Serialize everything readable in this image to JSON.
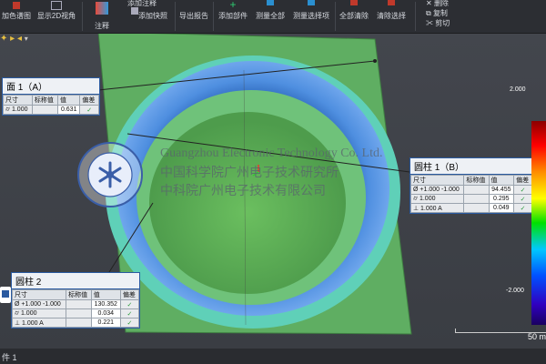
{
  "toolbar": {
    "items": [
      {
        "label": "加色谱图"
      },
      {
        "label": "显示2D视角"
      },
      {
        "label": "注释"
      },
      {
        "label": "添加快照"
      },
      {
        "label": "导出报告"
      },
      {
        "label": "添加部件"
      },
      {
        "label": "测量全部"
      },
      {
        "label": "测量选择项"
      },
      {
        "label": "全部清除"
      },
      {
        "label": "清除选择"
      }
    ],
    "small": {
      "top": "添加注释",
      "delete": "删除",
      "copy": "复制",
      "cut": "剪切"
    }
  },
  "panels": {
    "face1": {
      "title": "面 1（A）",
      "headers": [
        "尺寸",
        "标称值",
        "值",
        "偏差"
      ],
      "rows": [
        {
          "sym": "⌭ 1.000",
          "nominal": "",
          "value": "0.631",
          "mark": "✓"
        }
      ]
    },
    "cyl1": {
      "title": "圆柱 1（B）",
      "headers": [
        "尺寸",
        "标称值",
        "值",
        "偏差"
      ],
      "rows": [
        {
          "sym": "Ø +1.000 -1.000",
          "nominal": "",
          "value": "94.455",
          "mark": "✓"
        },
        {
          "sym": "⌭ 1.000",
          "nominal": "",
          "value": "0.295",
          "mark": "✓"
        },
        {
          "sym": "⊥ 1.000 A",
          "nominal": "",
          "value": "0.049",
          "mark": "✓"
        }
      ]
    },
    "cyl2": {
      "title": "圆柱 2",
      "headers": [
        "尺寸",
        "标称值",
        "值",
        "偏差"
      ],
      "rows": [
        {
          "sym": "Ø +1.000 -1.000",
          "nominal": "",
          "value": "130.352",
          "mark": "✓"
        },
        {
          "sym": "⌭ 1.000",
          "nominal": "",
          "value": "0.034",
          "mark": "✓"
        },
        {
          "sym": "⊥ 1.000 A",
          "nominal": "",
          "value": "0.221",
          "mark": "✓"
        }
      ]
    }
  },
  "watermark": {
    "en": "Guangzhou Electronic Technology Co. Ltd.",
    "cn1": "中国科学院广州电子技术研究所",
    "cn2": "中科院广州电子技术有限公司"
  },
  "legend": {
    "top": "2.000",
    "bottom": "-2.000"
  },
  "scale": "50 m",
  "status": "件 1",
  "colors": {
    "plate": "#5fae62",
    "ring": "#3a7fd0",
    "legend_red": "#ff0000"
  }
}
